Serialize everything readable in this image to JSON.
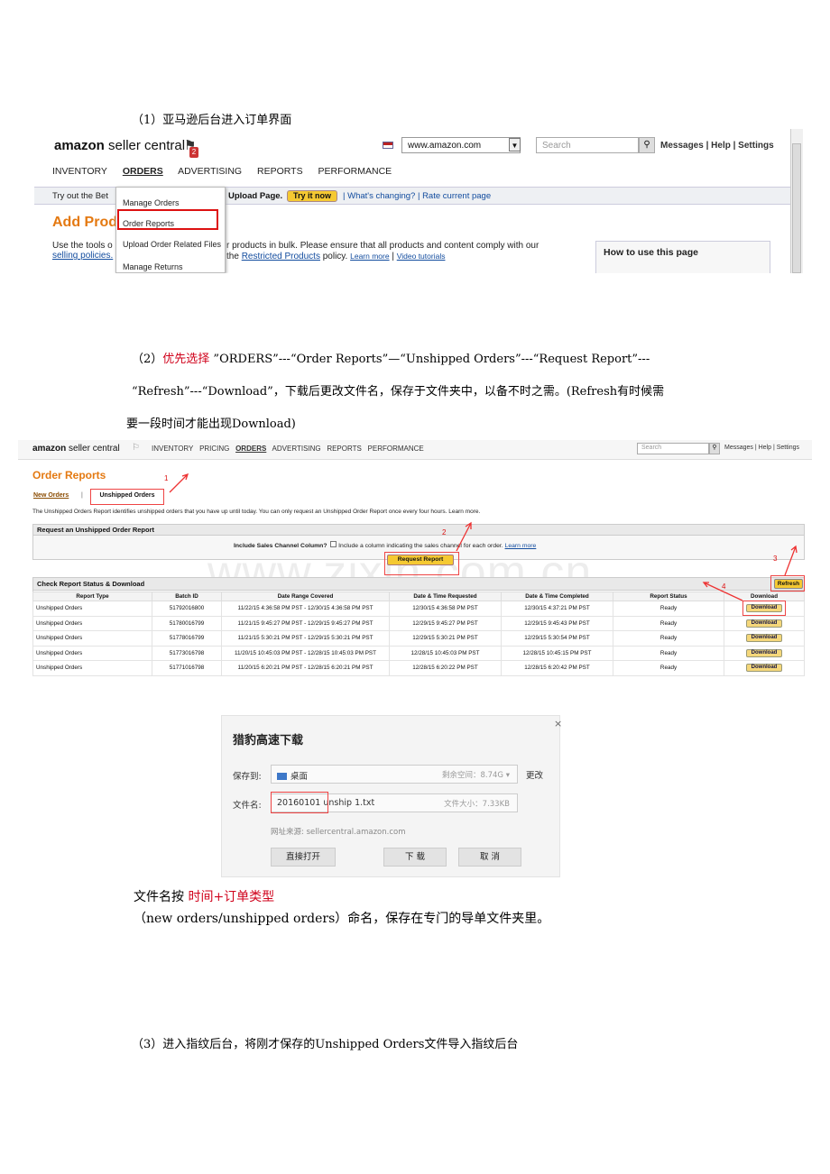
{
  "step1": {
    "heading": "（1）亚马逊后台进入订单界面"
  },
  "s1": {
    "logo_bold": "amazon",
    "logo_rest": " seller central",
    "badge": "2",
    "url": "www.amazon.com",
    "search_placeholder": "Search",
    "links": "Messages | Help | Settings",
    "nav": [
      "INVENTORY",
      "ORDERS",
      "ADVERTISING",
      "REPORTS",
      "PERFORMANCE"
    ],
    "bar_text": "Try out the Bet",
    "bar_bold": "Upload Page.",
    "try": "Try it now",
    "changing": "| What's changing? | Rate current page",
    "page_title": "Add Prod",
    "page_title_tail": "d",
    "p_left1": "Use the tools o",
    "p_left2": "selling policies.",
    "p_right1": "r products in bulk. Please ensure that all products and content comply with our",
    "p_right2_pre": "the ",
    "p_right2_link": "Restricted Products",
    "p_right2_post": " policy. ",
    "learn": "Learn more",
    "sep": " | ",
    "video": "Video tutorials",
    "menu": [
      "Manage Orders",
      "Order Reports",
      "Upload Order Related Files",
      "Manage Returns"
    ],
    "how": "How to use this page"
  },
  "step2": {
    "line1_pre": "（2）",
    "line1_red": "优先选择",
    "line1_post": " ”ORDERS”---“Order Reports”—“Unshipped Orders”---“Request Report”---",
    "line2": "“Refresh”---“Download”，下载后更改文件名，保存于文件夹中，以备不时之需。(Refresh有时候需",
    "line3": "要一段时间才能出现Download)"
  },
  "s2": {
    "logo_bold": "amazon",
    "logo_rest": " seller central",
    "nav": [
      "INVENTORY",
      "PRICING",
      "ORDERS",
      "ADVERTISING",
      "REPORTS",
      "PERFORMANCE"
    ],
    "search": "Search",
    "links": "Messages | Help | Settings",
    "title": "Order Reports",
    "tab_new": "New Orders",
    "tab_sep": "|",
    "tab_unshipped": "Unshipped Orders",
    "desc": "The Unshipped Orders Report identifies unshipped orders that you have up until today. You can only request an Unshipped Order Report once every four hours. Learn more.",
    "req_header": "Request an Unshipped Order Report",
    "include_label": "Include Sales Channel Column?",
    "include_text": "Include a column indicating the sales channel for each order.",
    "learn": "Learn more",
    "request_btn": "Request Report",
    "check_header": "Check Report Status & Download",
    "refresh": "Refresh",
    "columns": [
      "Report Type",
      "Batch ID",
      "Date Range Covered",
      "Date & Time Requested",
      "Date & Time Completed",
      "Report Status",
      "Download"
    ],
    "rows": [
      [
        "Unshipped Orders",
        "51792016800",
        "11/22/15 4:36:58 PM PST - 12/30/15 4:36:58 PM PST",
        "12/30/15 4:36:58 PM PST",
        "12/30/15 4:37:21 PM PST",
        "Ready",
        "Download"
      ],
      [
        "Unshipped Orders",
        "51780016799",
        "11/21/15 9:45:27 PM PST - 12/29/15 9:45:27 PM PST",
        "12/29/15 9:45:27 PM PST",
        "12/29/15 9:45:43 PM PST",
        "Ready",
        "Download"
      ],
      [
        "Unshipped Orders",
        "51778016799",
        "11/21/15 5:30:21 PM PST - 12/29/15 5:30:21 PM PST",
        "12/29/15 5:30:21 PM PST",
        "12/29/15 5:30:54 PM PST",
        "Ready",
        "Download"
      ],
      [
        "Unshipped Orders",
        "51773016798",
        "11/20/15 10:45:03 PM PST - 12/28/15 10:45:03 PM PST",
        "12/28/15 10:45:03 PM PST",
        "12/28/15 10:45:15 PM PST",
        "Ready",
        "Download"
      ],
      [
        "Unshipped Orders",
        "51771016798",
        "11/20/15 6:20:21 PM PST - 12/28/15 6:20:21 PM PST",
        "12/28/15 6:20:22 PM PST",
        "12/28/15 6:20:42 PM PST",
        "Ready",
        "Download"
      ]
    ],
    "markers": [
      "1",
      "2",
      "3",
      "4"
    ],
    "watermark": "www.zixin.com.cn"
  },
  "dialog": {
    "title": "猎豹高速下载",
    "close": "×",
    "save_label": "保存到:",
    "save_value": "桌面",
    "space": "剩余空间：8.74G",
    "change": "更改",
    "name_label": "文件名:",
    "name_value": "20160101 unship 1.txt",
    "size": "文件大小：7.33KB",
    "source": "网址来源: sellercentral.amazon.com",
    "open": "直接打开",
    "download": "下 载",
    "cancel": "取 消"
  },
  "naming": {
    "pre": "文件名按 ",
    "red": "时间+订单类型",
    "line2": "（new orders/unshipped orders）命名，保存在专门的导单文件夹里。"
  },
  "step3": {
    "heading": "（3）进入指纹后台，将刚才保存的Unshipped Orders文件导入指纹后台"
  }
}
